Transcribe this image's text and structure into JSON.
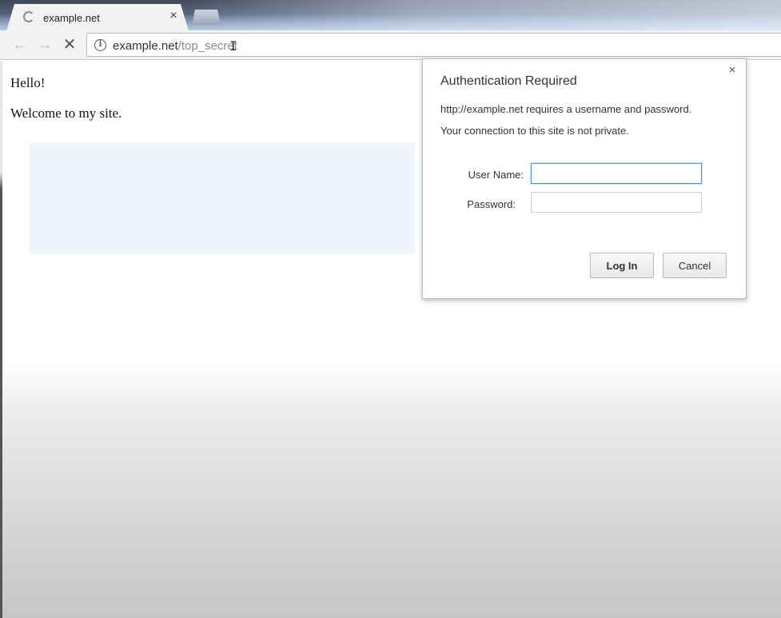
{
  "browser": {
    "tab": {
      "title": "example.net",
      "close_glyph": "×"
    },
    "toolbar": {
      "back_glyph": "←",
      "forward_glyph": "→",
      "stop_glyph": "✕",
      "url_host": "example.net",
      "url_path": "/top_secret"
    }
  },
  "page": {
    "greeting": "Hello!",
    "welcome": "Welcome to my site."
  },
  "auth_dialog": {
    "title": "Authentication Required",
    "message_line1": "http://example.net requires a username and password.",
    "message_line2": "Your connection to this site is not private.",
    "username_label": "User Name:",
    "username_value": "",
    "password_label": "Password:",
    "password_value": "",
    "login_label": "Log In",
    "cancel_label": "Cancel",
    "close_glyph": "×"
  },
  "icons": {
    "loading": "loading-spinner-icon",
    "info": "info-icon",
    "text_cursor": "text-cursor-icon"
  },
  "colors": {
    "focus_ring": "#4d90fe",
    "banner": "#eff5fb"
  }
}
